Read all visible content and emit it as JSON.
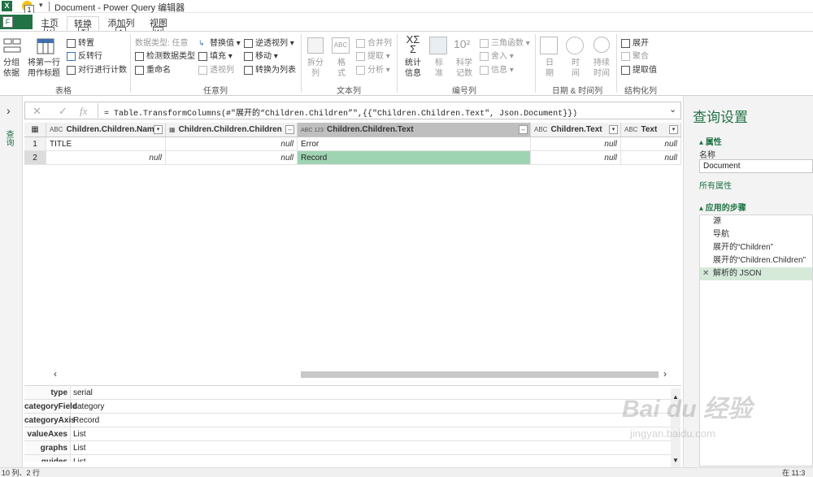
{
  "titlebar": {
    "app_icon": "X",
    "qat_arrow": "▾",
    "keytip_save": "1",
    "title": "Document - Power Query 编辑器"
  },
  "tabs": {
    "file": "文件",
    "file_keytip": "F",
    "items": [
      {
        "label": "主页",
        "keytip": "H"
      },
      {
        "label": "转换",
        "keytip": "T"
      },
      {
        "label": "添加列",
        "keytip": "A"
      },
      {
        "label": "视图",
        "keytip": "W"
      }
    ]
  },
  "ribbon": {
    "table_group": {
      "group_by": "分组\n依据",
      "first_row": "将第一行\n用作标题",
      "transpose": "转置",
      "reverse": "反转行",
      "count_rows": "对行进行计数",
      "label": "表格"
    },
    "anycol_group": {
      "data_type": "数据类型: 任意",
      "detect": "检测数据类型",
      "rename": "重命名",
      "replace": "替换值",
      "fill": "填充",
      "pivot": "透视列",
      "unpivot": "逆透视列",
      "move": "移动",
      "to_list": "转换为列表",
      "label": "任意列"
    },
    "text_group": {
      "split": "拆分\n列",
      "format": "格\n式",
      "merge": "合并列",
      "extract": "提取",
      "parse": "分析",
      "label": "文本列"
    },
    "number_group": {
      "stats": "统计\n信息",
      "standard": "标\n准",
      "scientific": "科学\n记数",
      "trig": "三角函数",
      "round": "舍入",
      "info": "信息",
      "sci_glyph": "10²",
      "label": "编号列"
    },
    "datetime_group": {
      "date": "日\n期",
      "time": "时\n间",
      "duration": "持续\n时间",
      "label": "日期 & 时间列"
    },
    "struct_group": {
      "expand": "展开",
      "aggregate": "聚合",
      "extract_values": "提取值",
      "label": "结构化列"
    }
  },
  "leftnav": {
    "label": "查询"
  },
  "formula": {
    "cancel": "✕",
    "confirm": "✓",
    "fx": "fx",
    "text": "= Table.TransformColumns(#\"展开的“Children.Children”\",{{\"Children.Children.Text\", Json.Document}})",
    "expand": "⌄"
  },
  "grid": {
    "columns": [
      {
        "name": "Children.Children.Name",
        "type": "ABC"
      },
      {
        "name": "Children.Children.Children",
        "type": "table"
      },
      {
        "name": "Children.Children.Text",
        "type": "ABC 123"
      },
      {
        "name": "Children.Text",
        "type": "ABC"
      },
      {
        "name": "Text",
        "type": "ABC"
      }
    ],
    "rows": [
      {
        "num": "1",
        "cells": [
          "TITLE",
          "null",
          "Error",
          "null",
          "null"
        ]
      },
      {
        "num": "2",
        "cells": [
          "null",
          "null",
          "Record",
          "null",
          "null"
        ]
      }
    ]
  },
  "props": [
    {
      "key": "type",
      "value": "serial"
    },
    {
      "key": "categoryField",
      "value": "category"
    },
    {
      "key": "categoryAxis",
      "value": "Record"
    },
    {
      "key": "valueAxes",
      "value": "List"
    },
    {
      "key": "graphs",
      "value": "List"
    },
    {
      "key": "guides",
      "value": "List"
    }
  ],
  "status": {
    "left": "10 列、2 行",
    "right": "在 11:3"
  },
  "rightpane": {
    "title": "查询设置",
    "properties": "▴ 属性",
    "name_label": "名称",
    "name_value": "Document",
    "all_props": "所有属性",
    "applied_steps": "▴ 应用的步骤",
    "steps": [
      "源",
      "导航",
      "展开的“Children”",
      "展开的“Children.Children”",
      "解析的 JSON"
    ],
    "delete_step": "✕"
  },
  "watermark": {
    "text": "Bai du 经验",
    "sub": "jingyan.baidu.com"
  }
}
